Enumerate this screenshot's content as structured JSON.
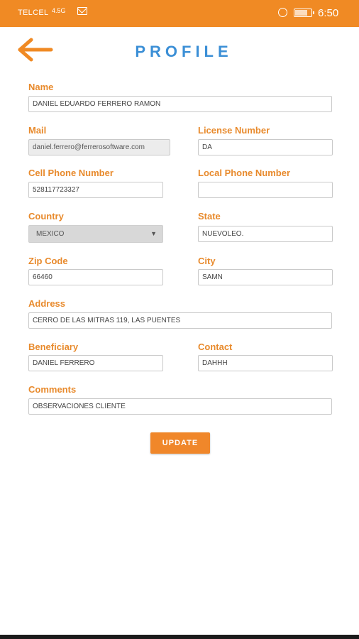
{
  "status_bar": {
    "carrier": "TELCEL",
    "network": "4.5G",
    "time": "6:50"
  },
  "header": {
    "title": "PROFILE"
  },
  "form": {
    "name": {
      "label": "Name",
      "value": "DANIEL EDUARDO FERRERO RAMON"
    },
    "mail": {
      "label": "Mail",
      "value": "daniel.ferrero@ferrerosoftware.com"
    },
    "license_number": {
      "label": "License Number",
      "value": "DA"
    },
    "cell_phone": {
      "label": "Cell Phone Number",
      "value": "528117723327"
    },
    "local_phone": {
      "label": "Local Phone Number",
      "value": ""
    },
    "country": {
      "label": "Country",
      "value": "MEXICO"
    },
    "state": {
      "label": "State",
      "value": "NUEVOLEO."
    },
    "zip_code": {
      "label": "Zip Code",
      "value": "66460"
    },
    "city": {
      "label": "City",
      "value": "SAMN"
    },
    "address": {
      "label": "Address",
      "value": "CERRO DE LAS MITRAS 119, LAS PUENTES"
    },
    "beneficiary": {
      "label": "Beneficiary",
      "value": "DANIEL FERRERO"
    },
    "contact": {
      "label": "Contact",
      "value": "DAHHH"
    },
    "comments": {
      "label": "Comments",
      "value": "OBSERVACIONES CLIENTE"
    }
  },
  "actions": {
    "update_label": "UPDATE"
  },
  "colors": {
    "accent": "#f08a24",
    "label": "#e88a2c",
    "title": "#3b8fd6"
  },
  "icons": [
    "back-arrow-icon",
    "signal-icon",
    "mail-icon",
    "alarm-icon",
    "battery-icon"
  ]
}
